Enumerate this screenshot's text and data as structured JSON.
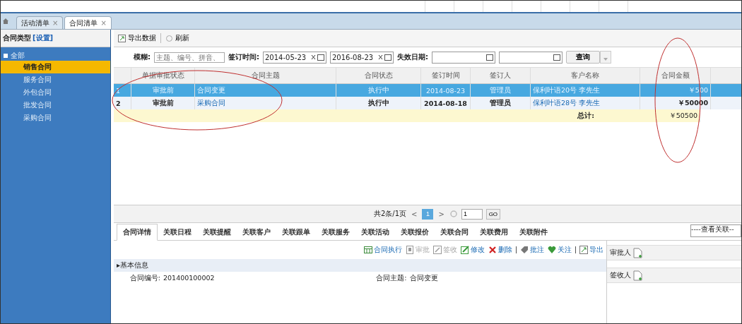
{
  "header_tabs": [
    {
      "label": "活动清单",
      "close": "×",
      "selected": false
    },
    {
      "label": "合同清单",
      "close": "×",
      "selected": true
    }
  ],
  "sidebar": {
    "title": "合同类型",
    "link": "[设置]",
    "tree": {
      "label": "全部",
      "expanded": true,
      "children": [
        {
          "label": "销售合同",
          "selected": true
        },
        {
          "label": "服务合同",
          "selected": false
        },
        {
          "label": "外包合同",
          "selected": false
        },
        {
          "label": "批发合同",
          "selected": false
        },
        {
          "label": "采购合同",
          "selected": false
        }
      ]
    }
  },
  "toolbar": [
    "导出数据",
    "刷新"
  ],
  "filters": {
    "fuzzy_label": "模糊:",
    "fuzzy_placeholder": "主题、编号、拼音、",
    "sign_label": "签订时间:",
    "sign_from": "2014-05-23",
    "sign_to": "2016-08-23",
    "expire_label": "失效日期:",
    "query": "查询"
  },
  "table": {
    "columns": [
      "单据审批状态",
      "合同主题",
      "合同状态",
      "签订时间",
      "签订人",
      "客户名称",
      "合同金额"
    ],
    "rows": [
      {
        "index": "1",
        "approval": "审批前",
        "subject": "合同变更",
        "status": "执行中",
        "date": "2014-08-23",
        "signer": "管理员",
        "customer": "保利叶语20号  李先生",
        "amount": "￥500",
        "selected": true
      },
      {
        "index": "2",
        "approval": "审批前",
        "subject": "采购合同",
        "status": "执行中",
        "date": "2014-08-18",
        "signer": "管理员",
        "customer": "保利叶语28号  李先生",
        "amount": "￥50000",
        "selected": false
      }
    ],
    "total_label": "总计:",
    "total": "￥50500"
  },
  "pagination": {
    "summary": "共2条/1页",
    "prev": "<",
    "page": "1",
    "next": ">",
    "input": "1",
    "go": "GO"
  },
  "detail_tabs": [
    {
      "label": "合同详情",
      "selected": true
    },
    {
      "label": "关联日程",
      "selected": false
    },
    {
      "label": "关联提醒",
      "selected": false
    },
    {
      "label": "关联客户",
      "selected": false
    },
    {
      "label": "关联跟单",
      "selected": false
    },
    {
      "label": "关联服务",
      "selected": false
    },
    {
      "label": "关联活动",
      "selected": false
    },
    {
      "label": "关联报价",
      "selected": false
    },
    {
      "label": "关联合同",
      "selected": false
    },
    {
      "label": "关联费用",
      "selected": false
    },
    {
      "label": "关联附件",
      "selected": false
    }
  ],
  "related_select": "----查看关联--",
  "actions": [
    {
      "kind": "execute",
      "label": "合同执行",
      "disabled": false
    },
    {
      "kind": "approve",
      "label": "审批",
      "disabled": true
    },
    {
      "kind": "receive",
      "label": "签收",
      "disabled": true
    },
    {
      "kind": "edit",
      "label": "修改",
      "disabled": false
    },
    {
      "kind": "delete",
      "label": "删除",
      "disabled": false
    },
    {
      "kind": "note",
      "label": "批注",
      "disabled": false
    },
    {
      "kind": "follow",
      "label": "关注",
      "disabled": false
    },
    {
      "kind": "export",
      "label": "导出",
      "disabled": false
    }
  ],
  "section": "▸基本信息",
  "fields": [
    {
      "label": "合同编号:",
      "value": "201400100002"
    },
    {
      "label": "合同主题:",
      "value": "合同变更"
    }
  ],
  "side_panel": [
    "审批人",
    "签收人"
  ]
}
